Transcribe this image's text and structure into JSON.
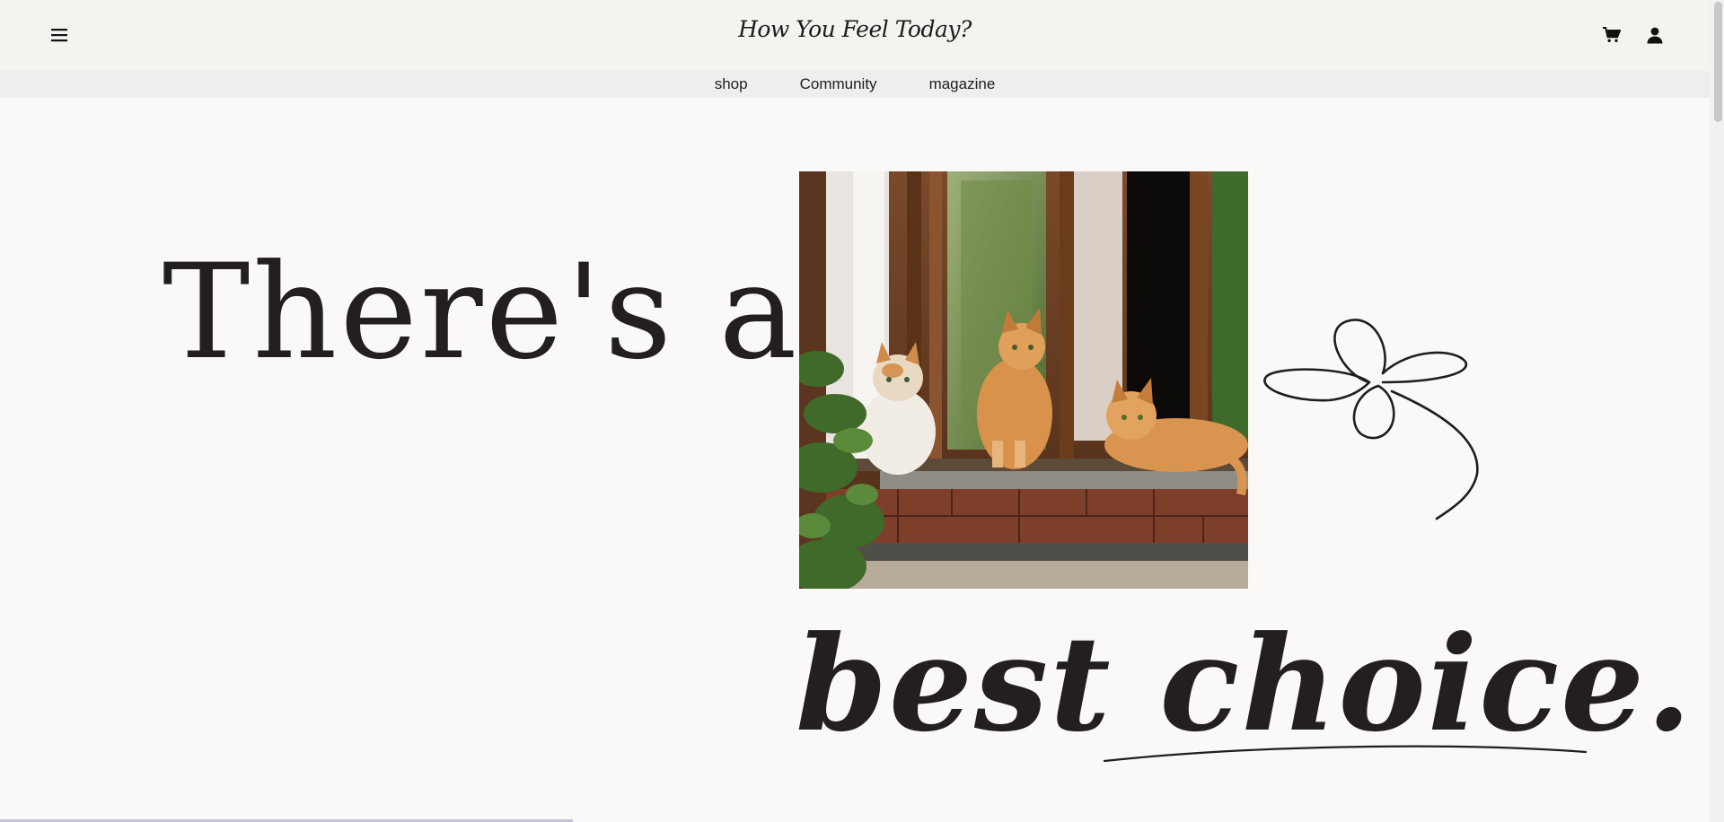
{
  "header": {
    "menu_icon": "hamburger-menu-icon",
    "brand": "How You Feel Today?",
    "cart_icon": "cart-icon",
    "account_icon": "user-icon"
  },
  "nav": {
    "items": [
      {
        "label": "shop"
      },
      {
        "label": "Community"
      },
      {
        "label": "magazine"
      }
    ]
  },
  "hero": {
    "line1": "There's a",
    "line2": "best choice.",
    "image_icon": "cats-on-windowsill-photo",
    "flourish_icon": "flower-doodle-icon"
  },
  "colors": {
    "background": "#faf9f7",
    "header_bg": "#f5f3ef",
    "nav_bg": "#eeeeed",
    "text": "#231f20"
  }
}
